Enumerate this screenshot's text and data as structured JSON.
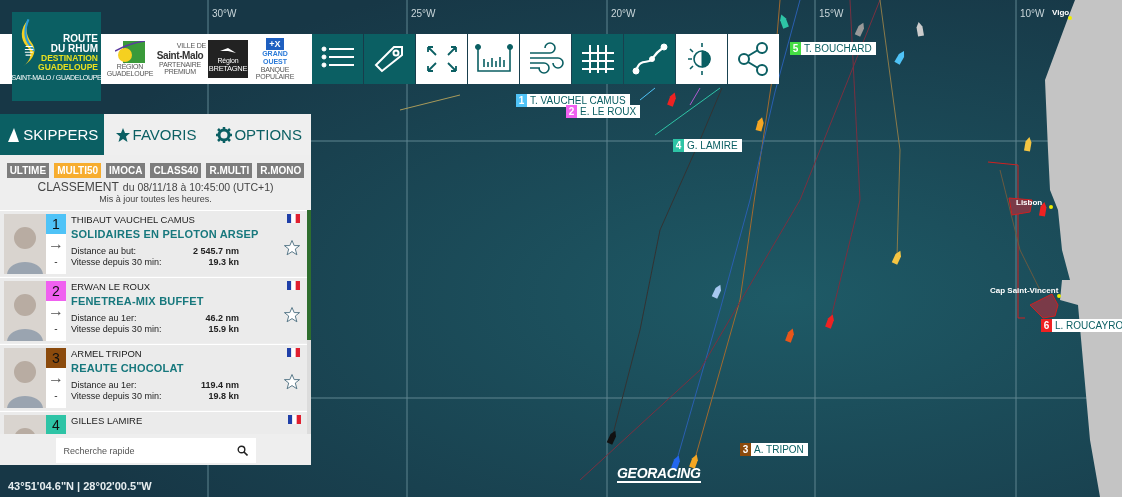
{
  "header": {
    "logo": {
      "title_lines": [
        "ROUTE",
        "DU RHUM"
      ],
      "subtitle_lines": [
        "DESTINATION",
        "GUADELOUPE"
      ],
      "tagline": "SAINT-MALO / GUADELOUPE"
    },
    "partners": [
      {
        "kind": "region",
        "lines": [
          "RÉGION",
          "GUADELOUPE"
        ]
      },
      {
        "kind": "city",
        "lines": [
          "VILLE DE",
          "Saint-Malo",
          "PARTENAIRE PREMIUM"
        ]
      },
      {
        "kind": "bretagne",
        "lines": [
          "Région",
          "BRETAGNE"
        ]
      },
      {
        "kind": "bank",
        "lines": [
          "+X",
          "GRAND OUEST",
          "BANQUE POPULAIRE"
        ]
      }
    ],
    "toolbar": [
      {
        "on": false
      },
      {
        "on": false
      },
      {
        "on": true
      },
      {
        "on": true
      },
      {
        "on": true
      },
      {
        "on": false
      },
      {
        "on": false
      },
      {
        "on": true
      },
      {
        "on": true
      }
    ]
  },
  "panel": {
    "tabs": [
      {
        "label": "SKIPPERS",
        "selected": true
      },
      {
        "label": "FAVORIS",
        "selected": false
      },
      {
        "label": "OPTIONS",
        "selected": false
      }
    ],
    "classes": [
      {
        "label": "ULTIME",
        "selected": false
      },
      {
        "label": "MULTI50",
        "selected": true
      },
      {
        "label": "IMOCA",
        "selected": false
      },
      {
        "label": "CLASS40",
        "selected": false
      },
      {
        "label": "R.MULTI",
        "selected": false
      },
      {
        "label": "R.MONO",
        "selected": false
      }
    ],
    "ranking": {
      "title": "CLASSEMENT",
      "date": "du 08/11/18 à 10:45:00 (UTC+1)",
      "note": "Mis à jour toutes les heures."
    },
    "skippers": [
      {
        "rank": "1",
        "color": "#4fc3f7",
        "trend": "→",
        "change": "-",
        "name": "THIBAUT VAUCHEL CAMUS",
        "boat": "SOLIDAIRES EN PELOTON ARSEP",
        "favorite": false,
        "stats": [
          {
            "label": "Distance au but:",
            "value": "2 545.7 nm"
          },
          {
            "label": "Vitesse depuis 30 min:",
            "value": "19.3 kn"
          }
        ]
      },
      {
        "rank": "2",
        "color": "#f060f0",
        "trend": "→",
        "change": "-",
        "name": "ERWAN LE ROUX",
        "boat": "FENETREA-MIX BUFFET",
        "favorite": false,
        "stats": [
          {
            "label": "Distance au 1er:",
            "value": "46.2 nm"
          },
          {
            "label": "Vitesse depuis 30 min:",
            "value": "15.9 kn"
          }
        ]
      },
      {
        "rank": "3",
        "color": "#8b4a0c",
        "trend": "→",
        "change": "-",
        "name": "ARMEL TRIPON",
        "boat": "REAUTE CHOCOLAT",
        "favorite": false,
        "stats": [
          {
            "label": "Distance au 1er:",
            "value": "119.4 nm"
          },
          {
            "label": "Vitesse depuis 30 min:",
            "value": "19.8 kn"
          }
        ]
      },
      {
        "rank": "4",
        "color": "#2ec4a6",
        "name": "GILLES LAMIRE"
      }
    ],
    "search": {
      "placeholder": "Recherche rapide"
    }
  },
  "map": {
    "meridians": [
      "30°W",
      "25°W",
      "20°W",
      "15°W",
      "10°W"
    ],
    "places": [
      "Vigo",
      "Lisbon",
      "Cap Saint-Vincent"
    ],
    "boat_labels": [
      {
        "rank": "1",
        "name": "T. VAUCHEL CAMUS",
        "color": "#4fc3f7"
      },
      {
        "rank": "2",
        "name": "E. LE ROUX",
        "color": "#f060f0"
      },
      {
        "rank": "4",
        "name": "G. LAMIRE",
        "color": "#2ec4a6"
      },
      {
        "rank": "5",
        "name": "T. BOUCHARD",
        "color": "#44dd44"
      },
      {
        "rank": "3",
        "name": "A. TRIPON",
        "color": "#8b4a0c"
      },
      {
        "rank": "6",
        "name": "L. ROUCAYRO",
        "color": "#ee2222"
      }
    ],
    "brand": "GEORACING",
    "coordinates": "43°51'04.6\"N | 28°02'00.5\"W"
  }
}
